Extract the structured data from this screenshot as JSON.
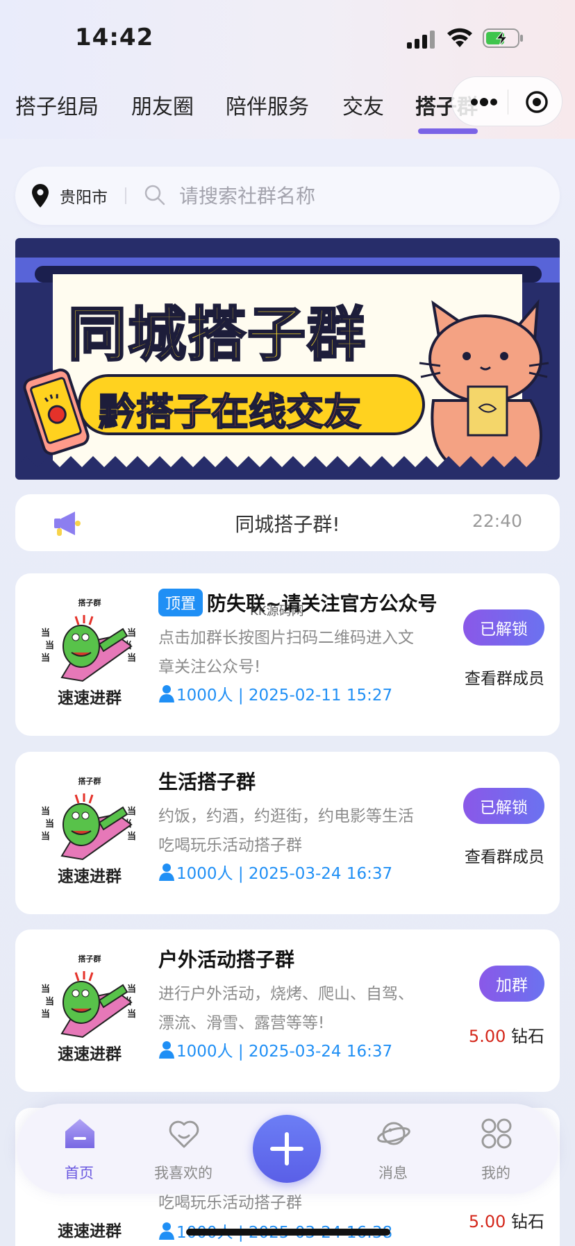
{
  "status_bar": {
    "time": "14:42"
  },
  "tabs": [
    {
      "label": "搭子组局"
    },
    {
      "label": "朋友圈"
    },
    {
      "label": "陪伴服务"
    },
    {
      "label": "交友"
    },
    {
      "label": "搭子群",
      "active": true
    }
  ],
  "search": {
    "city": "贵阳市",
    "placeholder": "请搜索社群名称"
  },
  "banner": {
    "title": "同城搭子群",
    "subtitle": "黔搭子在线交友"
  },
  "notice": {
    "text": "同城搭子群!",
    "time": "22:40"
  },
  "watermark": "KK源码网",
  "groups": [
    {
      "badge": "顶置",
      "title": "防失联~请关注官方公众号",
      "desc": "点击加群长按图片扫码二维码进入文章关注公众号!",
      "meta": "1000人 | 2025-02-11 15:27",
      "button": "已解锁",
      "secondary": "查看群成员",
      "thumb_caption": "速速进群",
      "thumb_small": "搭子群"
    },
    {
      "title": "生活搭子群",
      "desc": "约饭，约酒，约逛街，约电影等生活吃喝玩乐活动搭子群",
      "meta": "1000人 | 2025-03-24 16:37",
      "button": "已解锁",
      "secondary": "查看群成员",
      "thumb_caption": "速速进群",
      "thumb_small": "搭子群"
    },
    {
      "title": "户外活动搭子群",
      "desc": "进行户外活动，烧烤、爬山、自驾、漂流、滑雪、露营等等!",
      "meta": "1000人 | 2025-03-24 16:37",
      "button": "加群",
      "price": "5.00",
      "price_unit": "钻石",
      "thumb_caption": "速速进群",
      "thumb_small": "搭子群"
    },
    {
      "desc": "吃喝玩乐活动搭子群",
      "meta": "1000人 | 2025-03-24 16:38",
      "price": "5.00",
      "price_unit": "钻石",
      "thumb_caption": "速速进群"
    }
  ],
  "bottom_nav": [
    {
      "label": "首页",
      "active": true
    },
    {
      "label": "我喜欢的"
    },
    {
      "label": "消息"
    },
    {
      "label": "我的"
    }
  ]
}
